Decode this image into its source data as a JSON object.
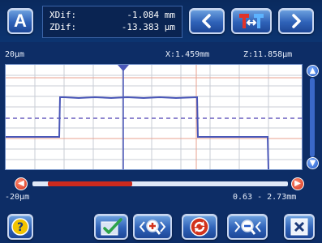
{
  "toolbar": {
    "mode_button_label": "A",
    "readout": {
      "xdif_label": "XDif:",
      "xdif_value": "-1.084 mm",
      "zdif_label": "ZDif:",
      "zdif_value": "-13.383 µm"
    }
  },
  "plot_info": {
    "scale_label": "20µm",
    "x_readout": "X:1.459mm",
    "z_readout": "Z:11.858µm",
    "neg_scale_label": "-20µm",
    "range_label": "0.63 - 2.73mm"
  },
  "scrollbar": {
    "position": 0.06,
    "extent": 0.33
  },
  "icons": {
    "prev": "chevron-left-icon",
    "next": "chevron-right-icon",
    "tool": "level-tool-icon",
    "help": "help-icon",
    "ok": "checkmark-icon",
    "zoom_in": "zoom-in-icon",
    "refresh": "refresh-icon",
    "zoom_out": "zoom-out-icon",
    "close": "close-icon"
  },
  "colors": {
    "profile_line": "#4a57b8",
    "reference_line": "#6a5fbf",
    "red_guide": "#e8a08f",
    "grid": "#c9cdd6",
    "accent_red": "#cc2a1e"
  }
}
